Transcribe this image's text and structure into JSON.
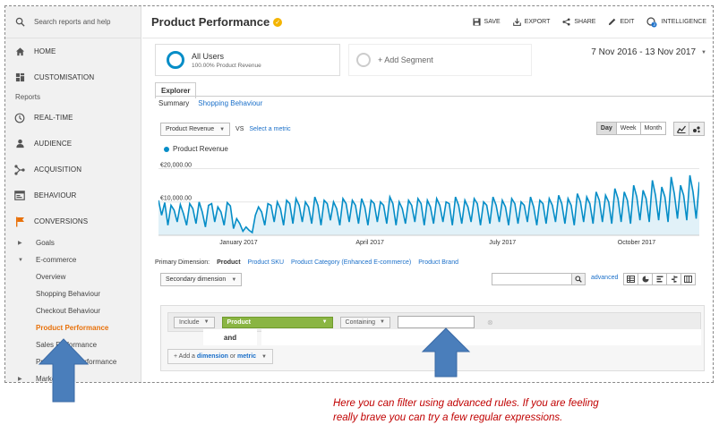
{
  "sidebar": {
    "search_placeholder": "Search reports and help",
    "top_items": [
      {
        "label": "HOME",
        "icon": "home-icon"
      },
      {
        "label": "CUSTOMISATION",
        "icon": "dashboard-icon"
      }
    ],
    "section_label": "Reports",
    "report_items": [
      {
        "label": "REAL-TIME",
        "icon": "clock-icon"
      },
      {
        "label": "AUDIENCE",
        "icon": "person-icon"
      },
      {
        "label": "ACQUISITION",
        "icon": "acquisition-icon"
      },
      {
        "label": "BEHAVIOUR",
        "icon": "behaviour-icon"
      },
      {
        "label": "CONVERSIONS",
        "icon": "flag-icon"
      }
    ],
    "conversions_sub": [
      {
        "label": "Goals",
        "expanded": false
      },
      {
        "label": "E-commerce",
        "expanded": true
      }
    ],
    "ecommerce_items": [
      "Overview",
      "Shopping Behaviour",
      "Checkout Behaviour",
      "Product Performance",
      "Sales Performance",
      "Product List Performance"
    ],
    "active_item": "Product Performance",
    "next_sub": "Marketing"
  },
  "header": {
    "title": "Product Performance",
    "actions": [
      {
        "label": "SAVE",
        "icon": "save-icon"
      },
      {
        "label": "EXPORT",
        "icon": "export-icon"
      },
      {
        "label": "SHARE",
        "icon": "share-icon"
      },
      {
        "label": "EDIT",
        "icon": "edit-icon"
      },
      {
        "label": "INTELLIGENCE",
        "icon": "intelligence-icon"
      }
    ]
  },
  "segments": {
    "segment_name": "All Users",
    "segment_sub": "100.00% Product Revenue",
    "add_segment": "+ Add Segment"
  },
  "date_range": "7 Nov 2016 - 13 Nov 2017",
  "tabs": {
    "explorer": "Explorer",
    "summary": "Summary",
    "shopping_behaviour": "Shopping Behaviour"
  },
  "metric_controls": {
    "metric": "Product Revenue",
    "vs": "VS",
    "select_metric": "Select a metric",
    "granularity": [
      "Day",
      "Week",
      "Month"
    ],
    "active_granularity": "Day"
  },
  "chart_data": {
    "type": "line",
    "series": [
      {
        "name": "Product Revenue",
        "color": "#058dc7"
      }
    ],
    "y_ticks": [
      "€20,000.00",
      "€10,000.00"
    ],
    "ylim": [
      0,
      22000
    ],
    "x_ticks": [
      "January 2017",
      "April 2017",
      "July 2017",
      "October 2017"
    ],
    "x_start": "2016-11-07",
    "x_end": "2017-11-13",
    "grid": true,
    "values": [
      10500,
      6000,
      9800,
      3000,
      9000,
      7500,
      4000,
      9200,
      6500,
      3000,
      9500,
      8000,
      3500,
      10000,
      7000,
      2500,
      9000,
      9500,
      4000,
      8500,
      7000,
      3000,
      9800,
      8800,
      2000,
      5000,
      3500,
      1200,
      2500,
      1500,
      800,
      6000,
      8500,
      7000,
      3000,
      9500,
      9000,
      4000,
      10000,
      8000,
      3000,
      10500,
      9500,
      3500,
      11000,
      9000,
      4000,
      10000,
      8500,
      3500,
      11500,
      9000,
      3000,
      10500,
      9500,
      4500,
      10000,
      8000,
      3000,
      11000,
      9500,
      4000,
      10500,
      9000,
      3500,
      11000,
      8500,
      3000,
      10500,
      9500,
      4000,
      10000,
      9000,
      3500,
      11500,
      9500,
      3000,
      10000,
      8000,
      3500,
      10500,
      9000,
      4000,
      11000,
      9500,
      3000,
      10500,
      8500,
      3500,
      11000,
      9000,
      4000,
      10000,
      9500,
      3000,
      11500,
      9000,
      3500,
      10500,
      8500,
      4000,
      11000,
      9500,
      3000,
      10000,
      9000,
      3500,
      11500,
      9000,
      4000,
      10500,
      8500,
      3000,
      11000,
      9500,
      3500,
      10000,
      9000,
      4000,
      11500,
      8500,
      3000,
      10500,
      9500,
      3500,
      11000,
      9000,
      4000,
      12000,
      9500,
      3500,
      11000,
      9000,
      3000,
      12500,
      10000,
      4000,
      11500,
      9500,
      3500,
      13000,
      10500,
      4000,
      12000,
      10000,
      3500,
      14000,
      11000,
      4000,
      13000,
      10500,
      3500,
      15000,
      11500,
      4500,
      13500,
      11000,
      4000,
      16500,
      12000,
      4500,
      14500,
      11500,
      4000,
      17500,
      12500,
      5000,
      15000,
      12000,
      4500,
      18000,
      13000,
      5000,
      16000
    ]
  },
  "primary_dimension": {
    "label": "Primary Dimension:",
    "items": [
      "Product",
      "Product SKU",
      "Product Category (Enhanced E-commerce)",
      "Product Brand"
    ],
    "active": "Product"
  },
  "table_tools": {
    "secondary_dimension": "Secondary dimension",
    "advanced": "advanced"
  },
  "filter": {
    "include": "Include",
    "dimension": "Product",
    "match": "Containing",
    "value": "",
    "and": "and",
    "add_prefix": "+ Add a ",
    "add_dimension": "dimension",
    "add_or": " or ",
    "add_metric": "metric"
  },
  "caption": {
    "line1": "Here you can filter using advanced rules. If you are feeling",
    "line2": "really brave you can try a few regular expressions."
  },
  "colors": {
    "accent": "#058dc7",
    "active": "#e8710a",
    "arrow": "#4a7ebb",
    "caption": "#c00000",
    "dimension": "#8ab543"
  }
}
